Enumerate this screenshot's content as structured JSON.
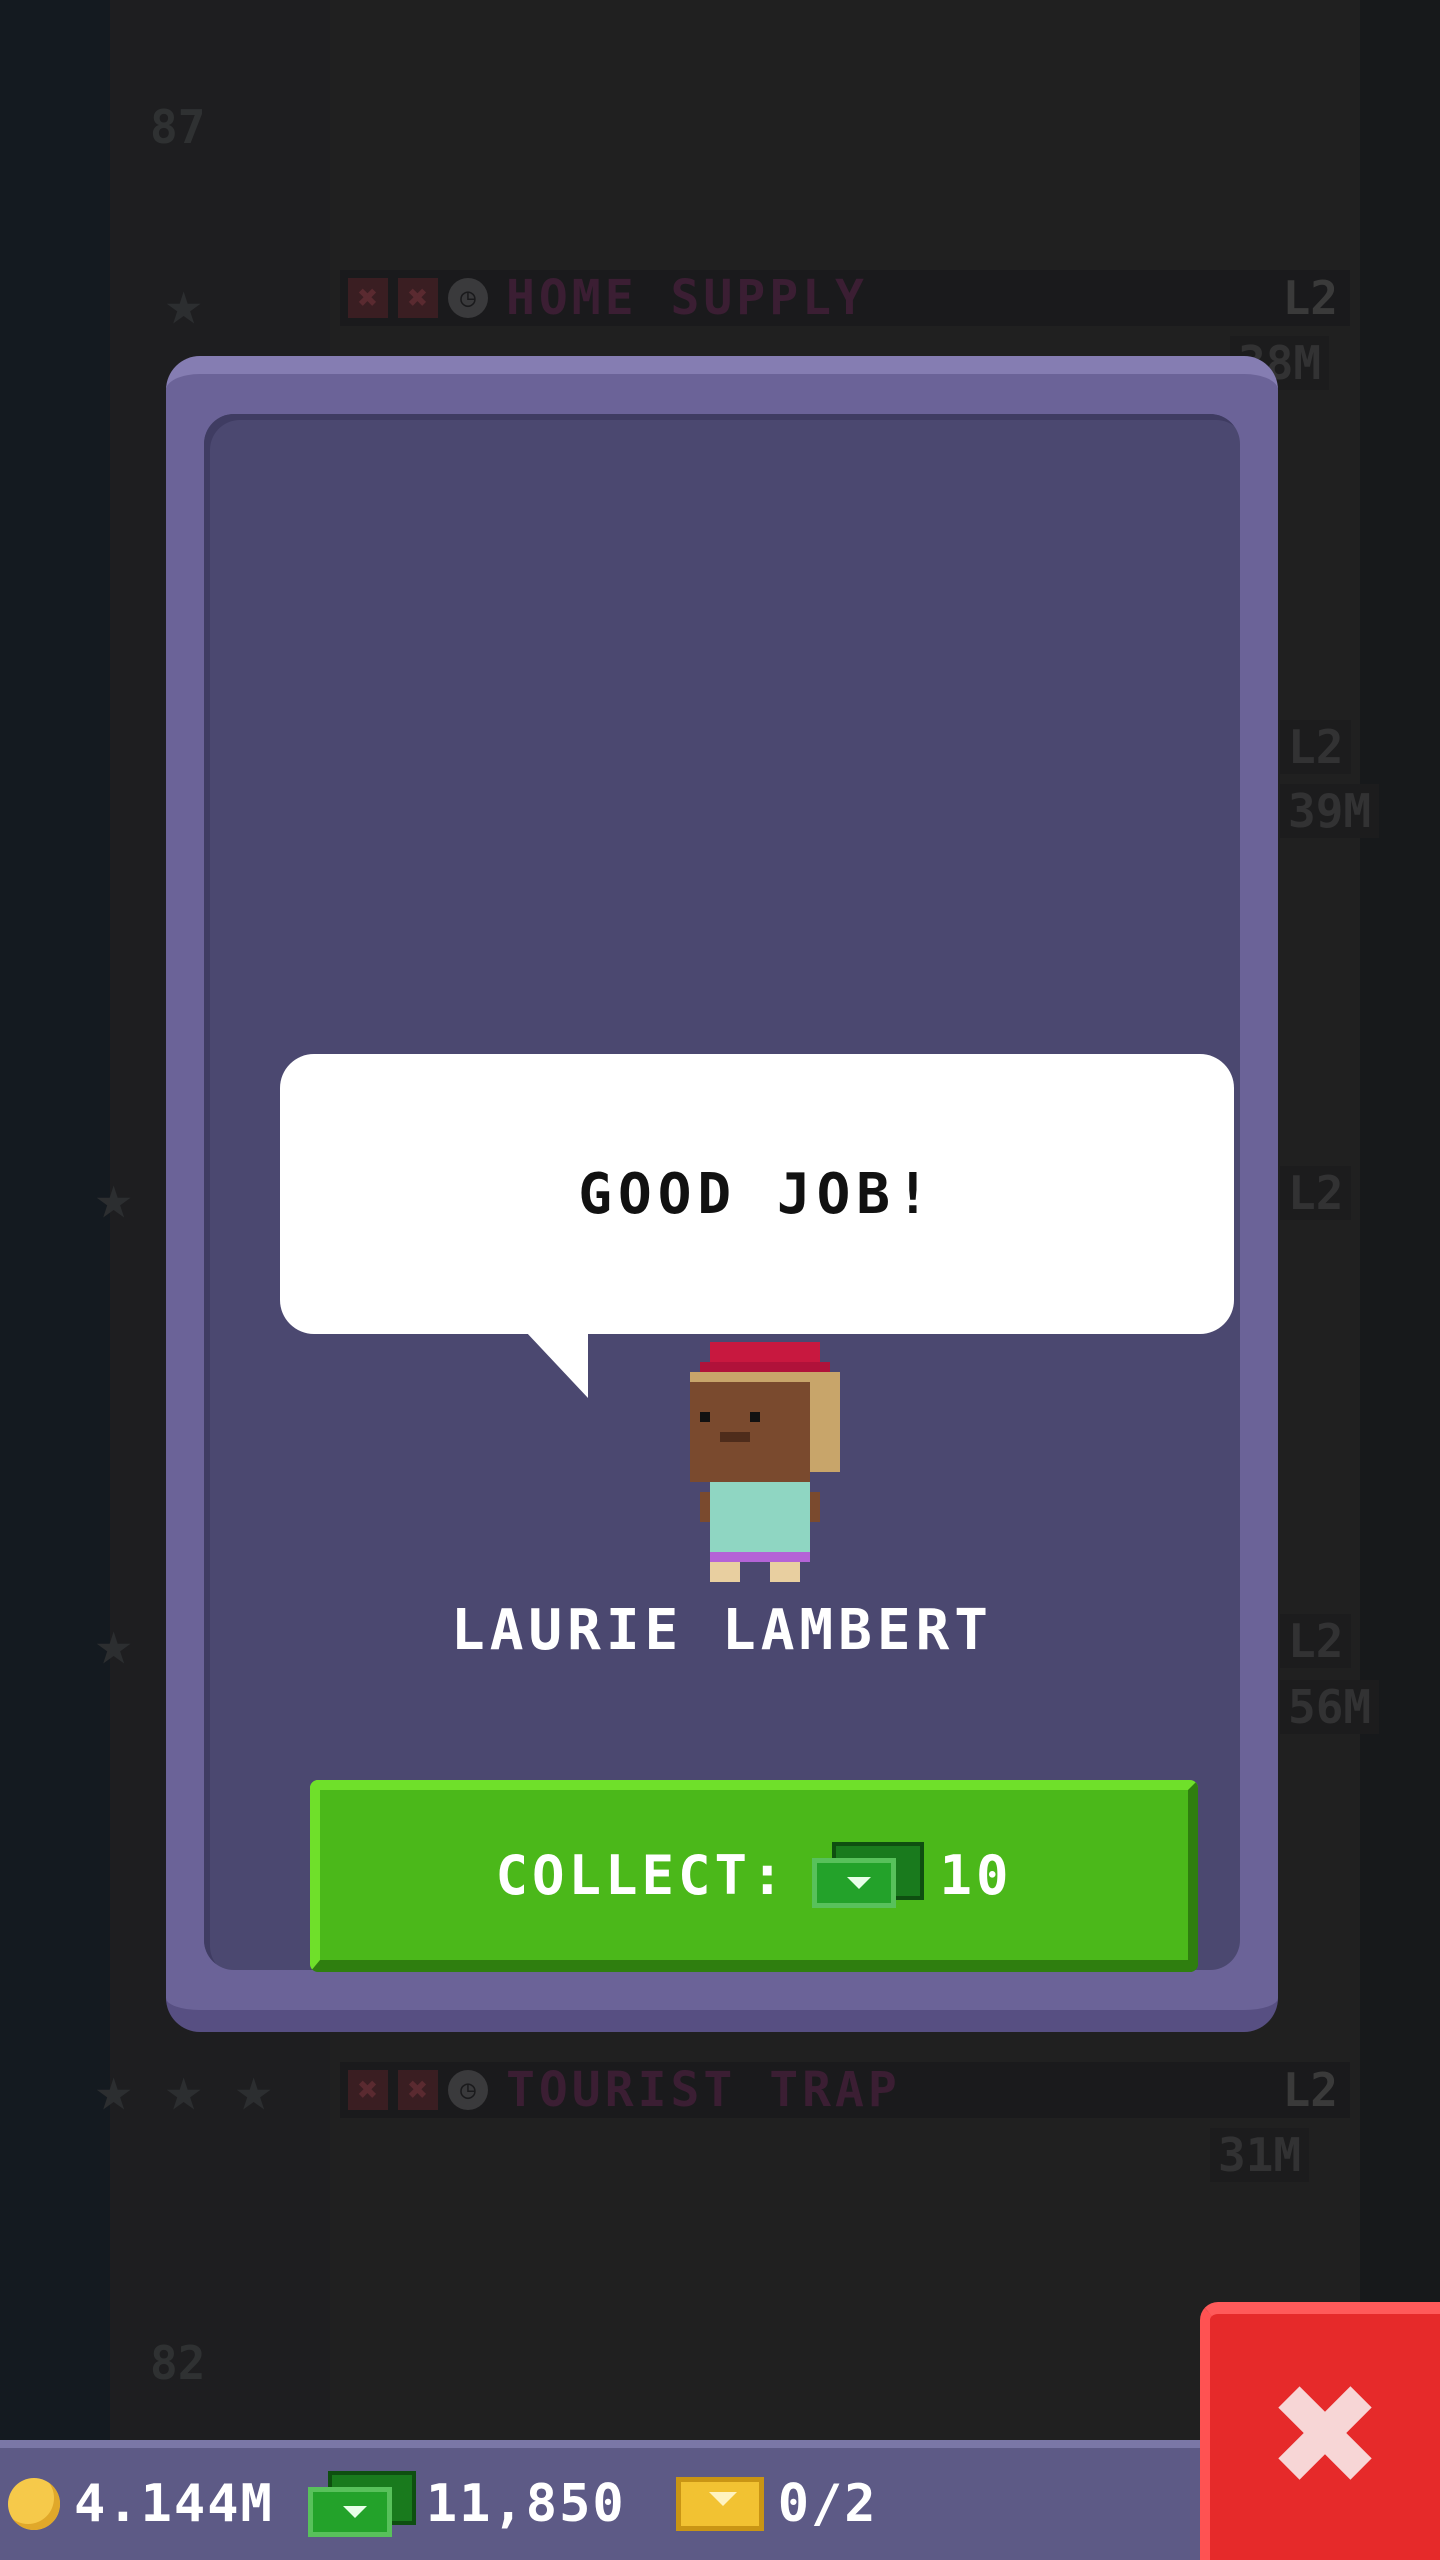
{
  "background": {
    "floors": [
      {
        "name": "HOME SUPPLY",
        "level": "L2",
        "value": "38M",
        "number": "87"
      },
      {
        "name": "TOURIST TRAP",
        "level": "L2",
        "value": "31M",
        "number": "82"
      }
    ],
    "side_levels": [
      "L2",
      "L2",
      "L2"
    ],
    "side_values": [
      "39M",
      "56M"
    ]
  },
  "dialog": {
    "message": "GOOD JOB!",
    "character_name": "LAURIE LAMBERT",
    "collect_label": "COLLECT:",
    "collect_amount": "10"
  },
  "hud": {
    "coins": "4.144M",
    "bux": "11,850",
    "tickets": "0/2"
  },
  "icons": {
    "coin": "coin-icon",
    "bux": "tower-bux-icon",
    "ticket": "golden-ticket-icon",
    "close": "close-x-icon"
  },
  "colors": {
    "card": "#6b6398",
    "card_inner": "#4b4870",
    "collect_button": "#4bb81a",
    "close_button": "#e62a2a",
    "hud": "#5d5a86"
  }
}
